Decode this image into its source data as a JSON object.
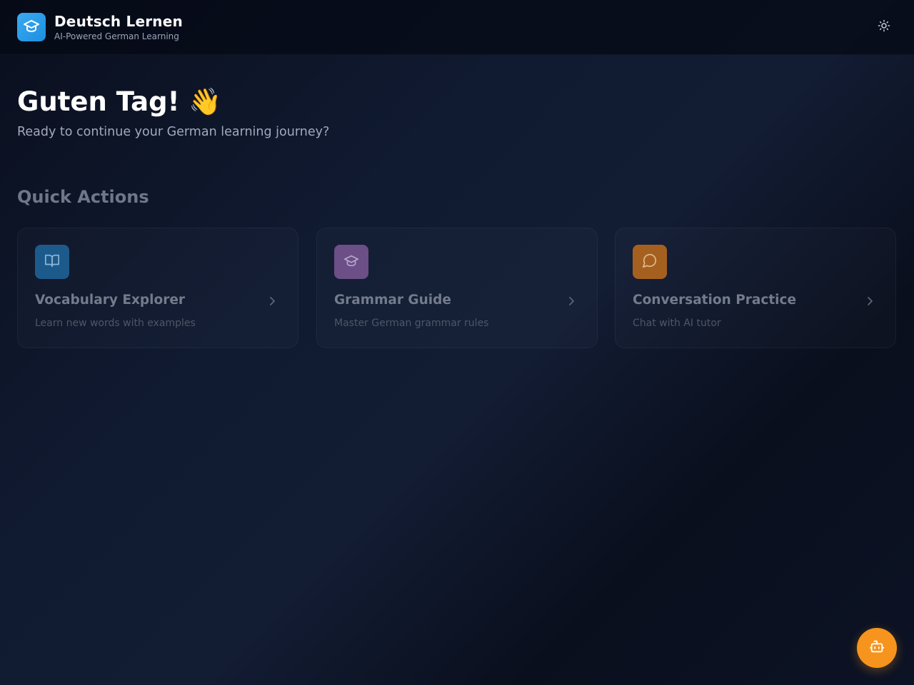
{
  "app": {
    "title": "Deutsch Lernen",
    "subtitle": "AI-Powered German Learning",
    "logo_icon": "graduation-cap-icon",
    "theme_toggle_icon": "sun-icon"
  },
  "hero": {
    "greeting": "Guten Tag! 👋",
    "subtitle": "Ready to continue your German learning journey?"
  },
  "quick_actions": {
    "title": "Quick Actions",
    "cards": [
      {
        "title": "Vocabulary Explorer",
        "description": "Learn new words with examples",
        "icon": "book-open-icon",
        "color": "#1d5a8c"
      },
      {
        "title": "Grammar Guide",
        "description": "Master German grammar rules",
        "icon": "graduation-cap-icon",
        "color": "#6b4f86"
      },
      {
        "title": "Conversation Practice",
        "description": "Chat with AI tutor",
        "icon": "message-circle-icon",
        "color": "#a5601f"
      }
    ]
  },
  "fab": {
    "icon": "bot-icon",
    "color": "#f7941d"
  },
  "colors": {
    "accent": "#2b9ae8",
    "background": "#0c1222"
  }
}
